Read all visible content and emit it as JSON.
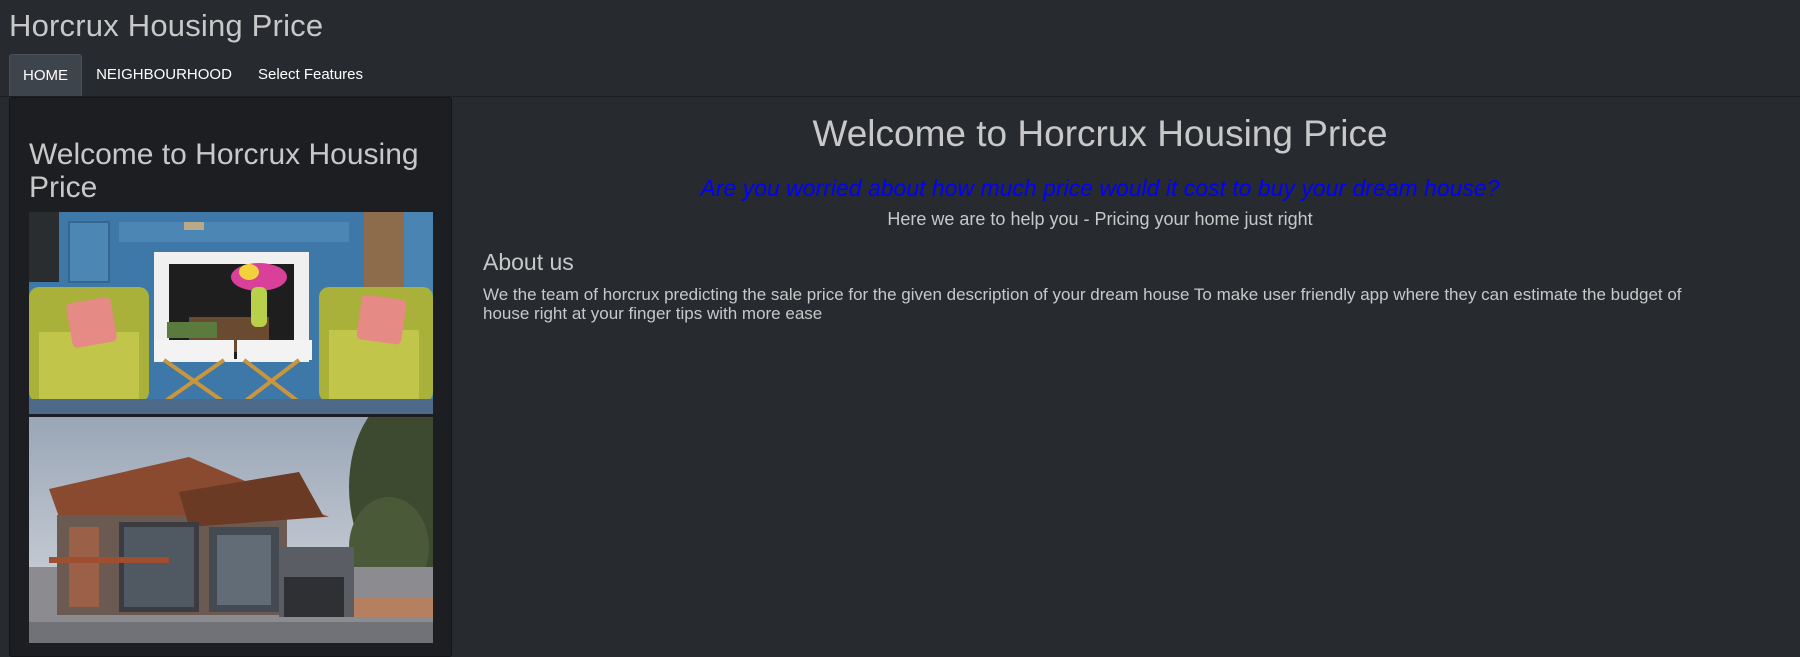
{
  "app": {
    "title": "Horcrux Housing Price"
  },
  "nav": {
    "tabs": [
      {
        "label": "HOME",
        "active": true
      },
      {
        "label": "NEIGHBOURHOOD",
        "active": false
      },
      {
        "label": "Select Features",
        "active": false
      }
    ]
  },
  "sidebar": {
    "title": "Welcome to Horcrux Housing Price",
    "images": [
      {
        "name": "living-room-photo",
        "description": "interior"
      },
      {
        "name": "house-exterior-photo",
        "description": "exterior"
      }
    ]
  },
  "main": {
    "title": "Welcome to Horcrux Housing Price",
    "tagline": "Are you worried about how much price would it cost to buy your dream house?",
    "tagline_color": "#0000ff",
    "sub_tagline": "Here we are to help you - Pricing your home just right",
    "about": {
      "heading": "About us",
      "text": "We the team of horcrux predicting the sale price for the given description of your dream house To make user friendly app where they can estimate the budget of house right at your finger tips with more ease"
    }
  },
  "colors": {
    "background": "#272b30",
    "sidebar_bg": "#1c1e22",
    "active_tab_bg": "#3e444c",
    "text": "#c8c8c8"
  }
}
